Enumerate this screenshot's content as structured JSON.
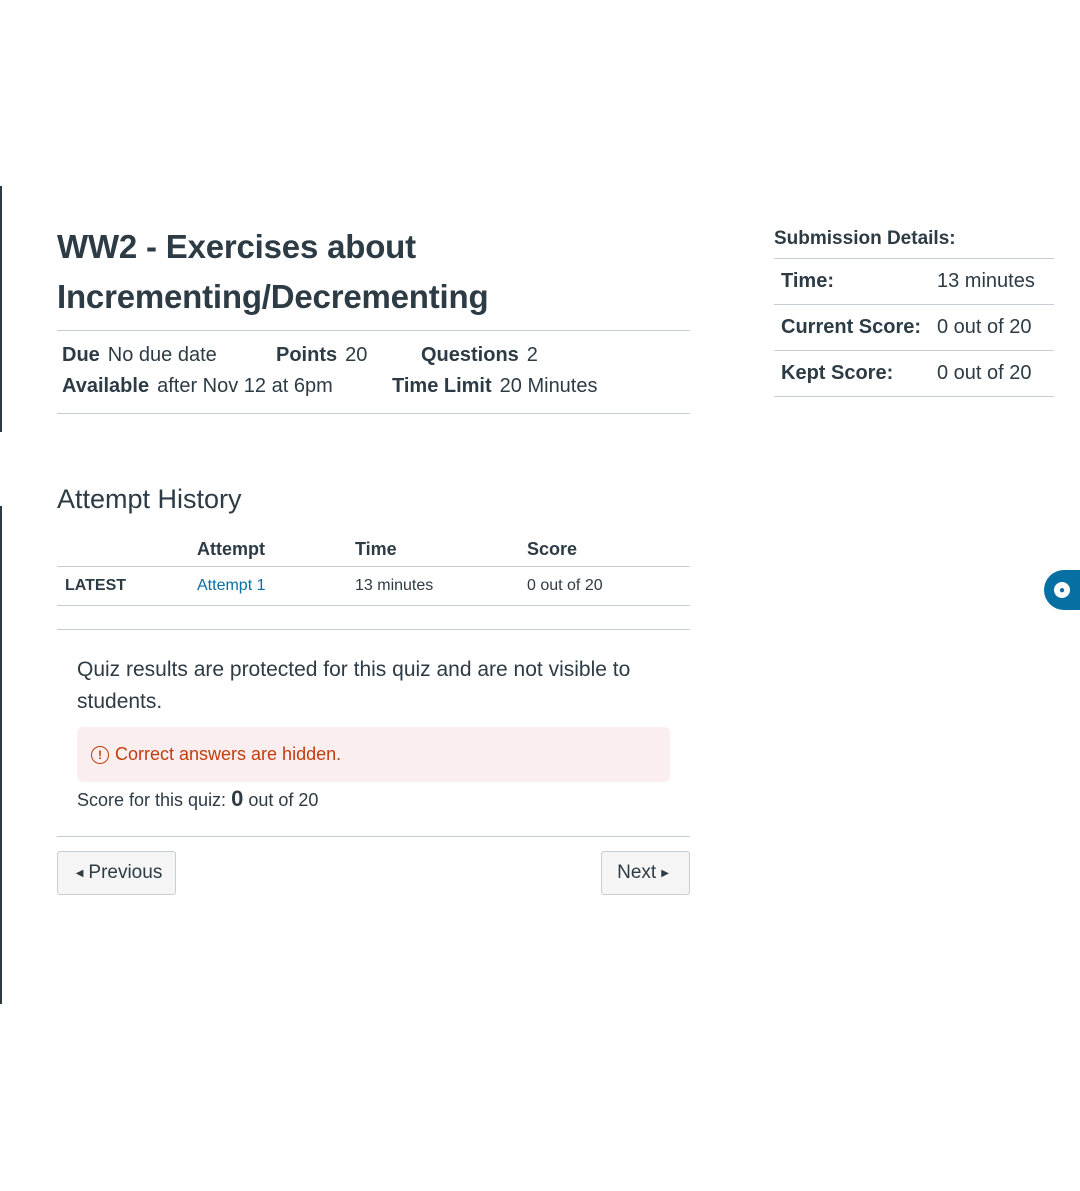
{
  "quiz": {
    "title_line1": "WW2 - Exercises about",
    "title_line2": "Incrementing/Decrementing",
    "due_label": "Due",
    "due_value": "No due date",
    "points_label": "Points",
    "points_value": "20",
    "questions_label": "Questions",
    "questions_value": "2",
    "available_label": "Available",
    "available_value": "after Nov 12 at 6pm",
    "time_limit_label": "Time Limit",
    "time_limit_value": "20 Minutes"
  },
  "attempt_history": {
    "heading": "Attempt History",
    "columns": [
      "",
      "Attempt",
      "Time",
      "Score"
    ],
    "rows": [
      {
        "tag": "LATEST",
        "attempt": "Attempt 1",
        "time": "13 minutes",
        "score": "0 out of 20"
      }
    ]
  },
  "results": {
    "protected_message": "Quiz results are protected for this quiz and are not visible to students.",
    "alert_icon": "warning-circle-icon",
    "alert_text": "Correct answers are hidden.",
    "score_prefix": "Score for this quiz:",
    "score_value": "0",
    "score_suffix": "out of 20"
  },
  "navigation": {
    "previous_label": "Previous",
    "next_label": "Next"
  },
  "submission_details": {
    "heading": "Submission Details:",
    "rows": [
      {
        "label": "Time:",
        "value": "13 minutes"
      },
      {
        "label": "Current Score:",
        "value": "0 out of 20"
      },
      {
        "label": "Kept Score:",
        "value": "0 out of 20"
      }
    ]
  },
  "colors": {
    "text": "#2d3b45",
    "link": "#0770a3",
    "alert_text": "#c23c0d",
    "alert_bg": "#fbeeee"
  }
}
